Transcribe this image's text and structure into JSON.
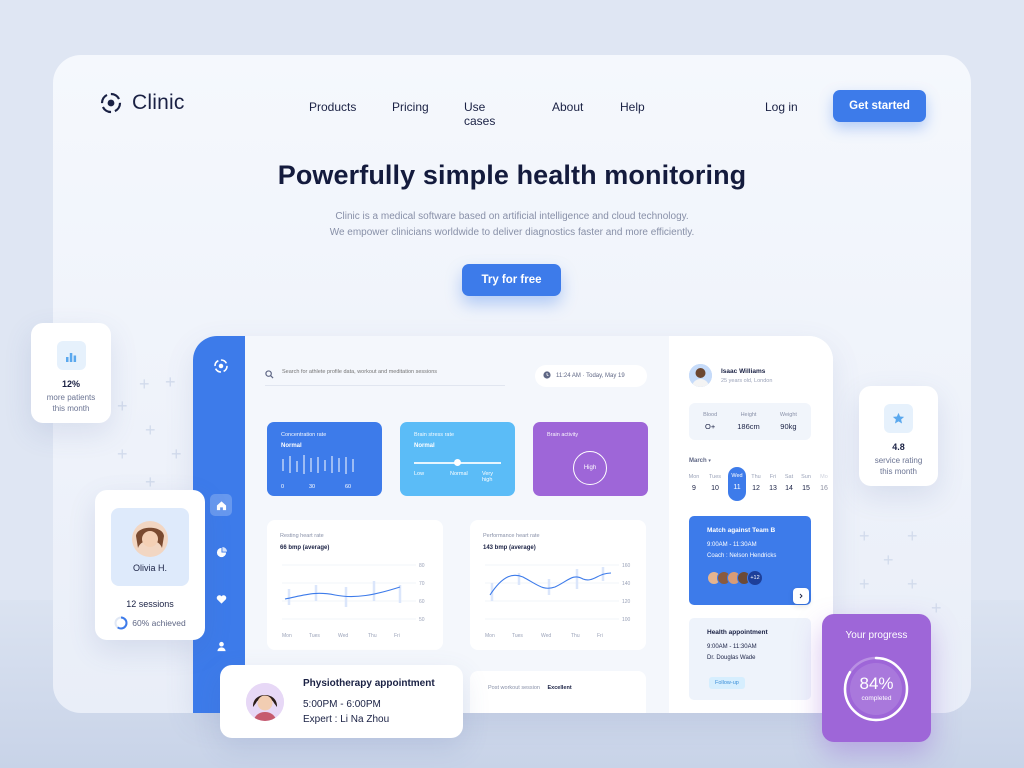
{
  "brand": {
    "name": "Clinic"
  },
  "nav": {
    "links": [
      "Products",
      "Pricing",
      "Use cases",
      "About",
      "Help"
    ],
    "login": "Log in",
    "cta": "Get started"
  },
  "hero": {
    "title": "Powerfully simple health monitoring",
    "subtitle_line1": "Clinic is a medical software based on artificial intelligence and cloud technology.",
    "subtitle_line2": "We empower clinicians worldwide to deliver diagnostics faster and more efficiently.",
    "cta": "Try for free"
  },
  "dashboard": {
    "search_placeholder": "Search for athlete profile data, workout and meditation sessions",
    "time": "11:24 AM · Today, May 19",
    "metrics": [
      {
        "title": "Concentration rate",
        "sub": "Normal",
        "ticks": [
          "0",
          "30",
          "60"
        ],
        "color": "#3d7bea"
      },
      {
        "title": "Brain stress rate",
        "sub": "Normal",
        "ticks": [
          "Low",
          "Normal",
          "Very high"
        ],
        "level": 0.5,
        "color": "#5bbcf7"
      },
      {
        "title": "Brain activity",
        "value": "High",
        "color": "#9e66d8"
      }
    ],
    "resting": {
      "title": "Resting heart rate",
      "sub": "66 bmp (average)",
      "days": [
        "Mon",
        "Tues",
        "Wed",
        "Thu",
        "Fri"
      ],
      "yticks": [
        "80",
        "70",
        "60",
        "50"
      ]
    },
    "performance": {
      "title": "Performance heart rate",
      "sub": "143 bmp (average)",
      "days": [
        "Mon",
        "Tues",
        "Wed",
        "Thu",
        "Fri"
      ],
      "yticks": [
        "160",
        "140",
        "120",
        "100"
      ]
    },
    "post_workout": {
      "label": "Post workout session",
      "value": "Excellent"
    },
    "profile": {
      "name": "Isaac Williams",
      "detail": "25 years old, London"
    },
    "stats": [
      {
        "label": "Blood",
        "value": "O+"
      },
      {
        "label": "Height",
        "value": "186cm"
      },
      {
        "label": "Weight",
        "value": "90kg"
      }
    ],
    "month": "March",
    "calendar": [
      {
        "day": "Mon",
        "num": "9"
      },
      {
        "day": "Tues",
        "num": "10"
      },
      {
        "day": "Wed",
        "num": "11"
      },
      {
        "day": "Thu",
        "num": "12"
      },
      {
        "day": "Fri",
        "num": "13"
      },
      {
        "day": "Sat",
        "num": "14"
      },
      {
        "day": "Sun",
        "num": "15"
      },
      {
        "day": "Mo",
        "num": "16"
      }
    ],
    "event1": {
      "title": "Match against Team B",
      "time": "9:00AM - 11:30AM",
      "coach": "Coach : Nelson Hendricks",
      "more": "+12"
    },
    "event2": {
      "title": "Health appointment",
      "time": "9:00AM - 11:30AM",
      "doctor": "Dr. Douglas Wade",
      "tag": "Follow-up"
    }
  },
  "float_cards": {
    "patients": {
      "value": "12%",
      "line1": "more patients",
      "line2": "this month"
    },
    "rating": {
      "value": "4.8",
      "line1": "service rating",
      "line2": "this month"
    },
    "olivia": {
      "name": "Olivia H.",
      "sessions": "12 sessions",
      "achieved": "60% achieved",
      "achieved_fraction": 0.6
    },
    "physio": {
      "title": "Physiotherapy appointment",
      "time": "5:00PM - 6:00PM",
      "expert": "Expert : Li Na Zhou"
    },
    "progress": {
      "title": "Your progress",
      "value": "84%",
      "sub": "completed",
      "fraction": 0.84
    }
  },
  "colors": {
    "primary": "#3d7bea",
    "sky": "#5bbcf7",
    "purple": "#9e66d8",
    "navy": "#141b3d"
  }
}
